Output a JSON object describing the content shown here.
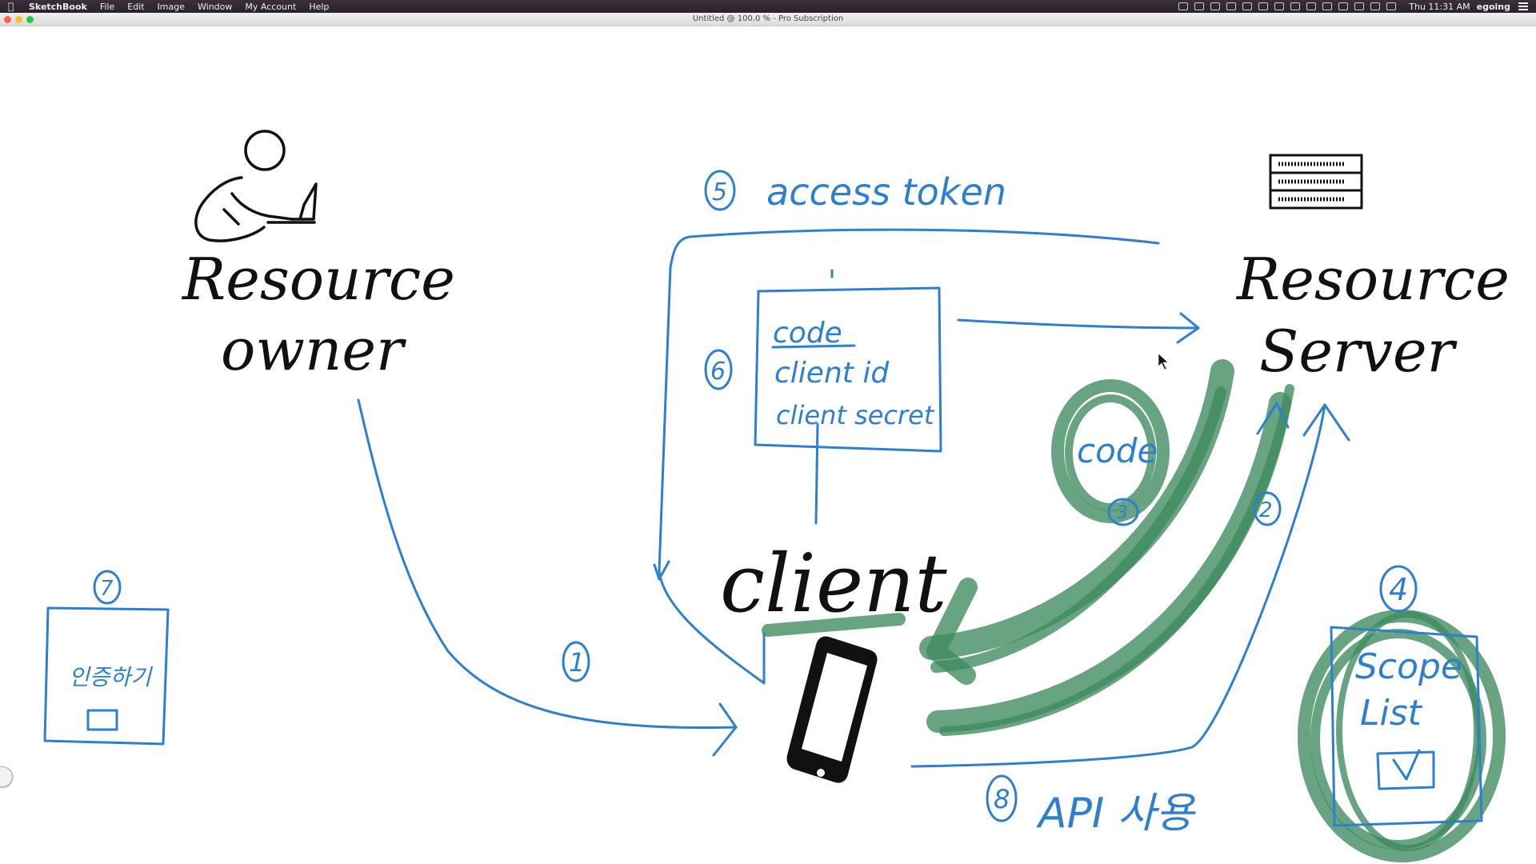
{
  "menubar": {
    "app_name": "SketchBook",
    "menus": [
      "File",
      "Edit",
      "Image",
      "Window",
      "My Account",
      "Help"
    ],
    "clock": "Thu 11:31 AM",
    "user": "egoing"
  },
  "window": {
    "title": "Untitled @ 100.0 % - Pro Subscription"
  },
  "colors": {
    "blue_ink": "#2f7fcf",
    "black_ink": "#111111",
    "green_highlighter": "#3d8a5e",
    "menubar_bg": "#2b222b"
  },
  "sketch": {
    "resource_owner": {
      "line1": "Resource",
      "line2": "owner"
    },
    "resource_server": {
      "line1": "Resource",
      "line2": "Server"
    },
    "client": "client",
    "access_token": "access token",
    "code_box": {
      "line1": "code",
      "line2": "client id",
      "line3": "client secret"
    },
    "code_circle": "code",
    "scope_box": {
      "line1": "Scope",
      "line2": "List"
    },
    "api_call": "API 사용",
    "login_box": "인증하기",
    "step_labels": {
      "one": "1",
      "two": "2",
      "three": "3",
      "four": "4",
      "five": "5",
      "six": "6",
      "seven": "7",
      "eight": "8"
    }
  }
}
